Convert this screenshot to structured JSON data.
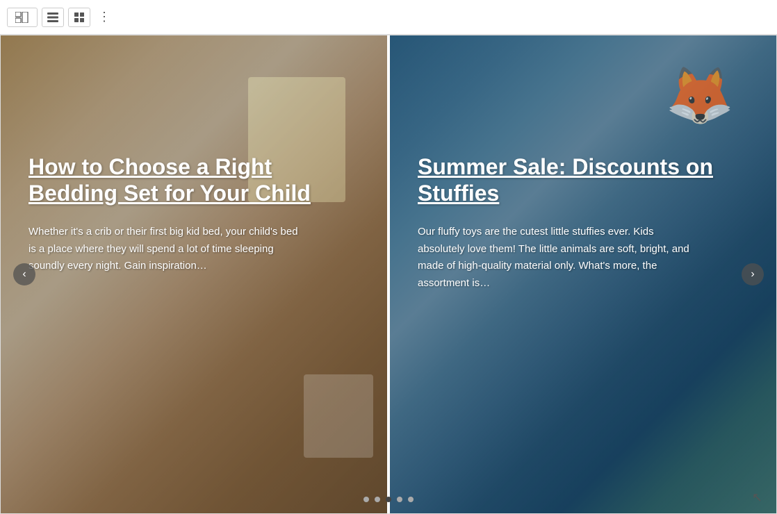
{
  "toolbar": {
    "btn1_icon": "⊞",
    "btn2_icon": "☰",
    "btn3_icon": "▣",
    "more_icon": "⋮"
  },
  "slides": [
    {
      "id": "slide-left",
      "title": "How to Choose a Right Bedding Set for Your Child",
      "body": "Whether it's a crib or their first big kid bed, your child's bed is a place where they will spend a lot of time sleeping soundly every night. Gain inspiration…"
    },
    {
      "id": "slide-right",
      "title": "Summer Sale: Discounts on Stuffies",
      "body": "Our fluffy toys are the cutest little stuffies ever. Kids absolutely love them! The little animals are soft, bright, and made of high-quality material only. What's more, the assortment is…"
    }
  ],
  "dots": [
    {
      "id": 1,
      "active": false
    },
    {
      "id": 2,
      "active": false
    },
    {
      "id": 3,
      "active": true
    },
    {
      "id": 4,
      "active": false
    },
    {
      "id": 5,
      "active": false
    }
  ],
  "nav": {
    "prev_icon": "‹",
    "next_icon": "›"
  }
}
